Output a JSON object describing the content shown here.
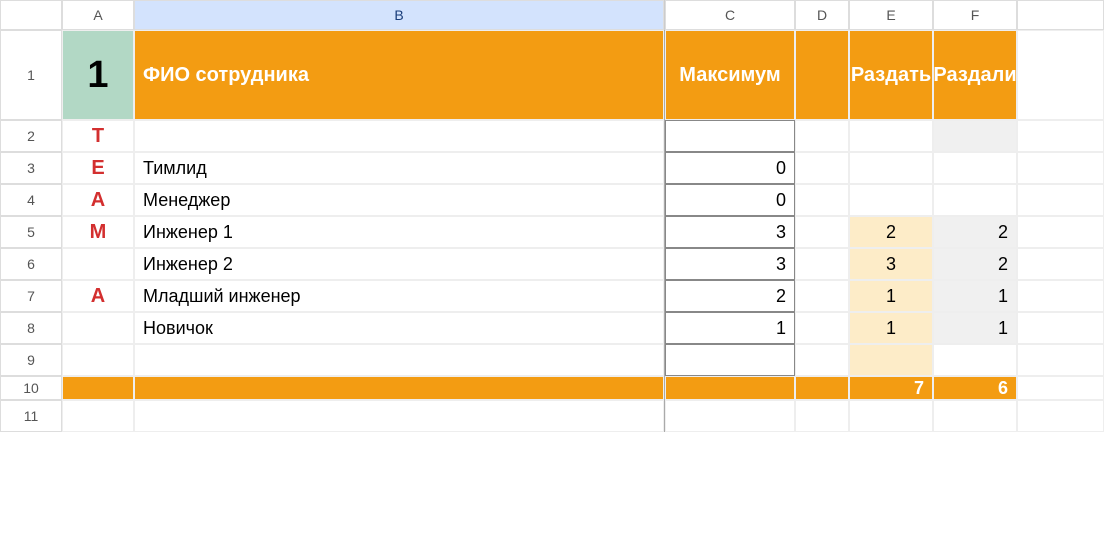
{
  "columns": [
    "A",
    "B",
    "C",
    "D",
    "E",
    "F"
  ],
  "rows": [
    "1",
    "2",
    "3",
    "4",
    "5",
    "6",
    "7",
    "8",
    "9",
    "10",
    "11"
  ],
  "main_number": "1",
  "headers": {
    "B": "ФИО сотрудника",
    "C": "Максимум",
    "E": "Раздать",
    "F": "Раздали"
  },
  "team_letters": [
    "T",
    "E",
    "A",
    "M",
    "",
    "A",
    ""
  ],
  "people": [
    {
      "name": "",
      "max": "",
      "give": "",
      "gave": ""
    },
    {
      "name": "Тимлид",
      "max": "0",
      "give": "",
      "gave": ""
    },
    {
      "name": "Менеджер",
      "max": "0",
      "give": "",
      "gave": ""
    },
    {
      "name": "Инженер 1",
      "max": "3",
      "give": "2",
      "gave": "2"
    },
    {
      "name": "Инженер 2",
      "max": "3",
      "give": "3",
      "gave": "2"
    },
    {
      "name": "Младший инженер",
      "max": "2",
      "give": "1",
      "gave": "1"
    },
    {
      "name": "Новичок",
      "max": "1",
      "give": "1",
      "gave": "1"
    }
  ],
  "totals": {
    "E": "7",
    "F": "6"
  }
}
